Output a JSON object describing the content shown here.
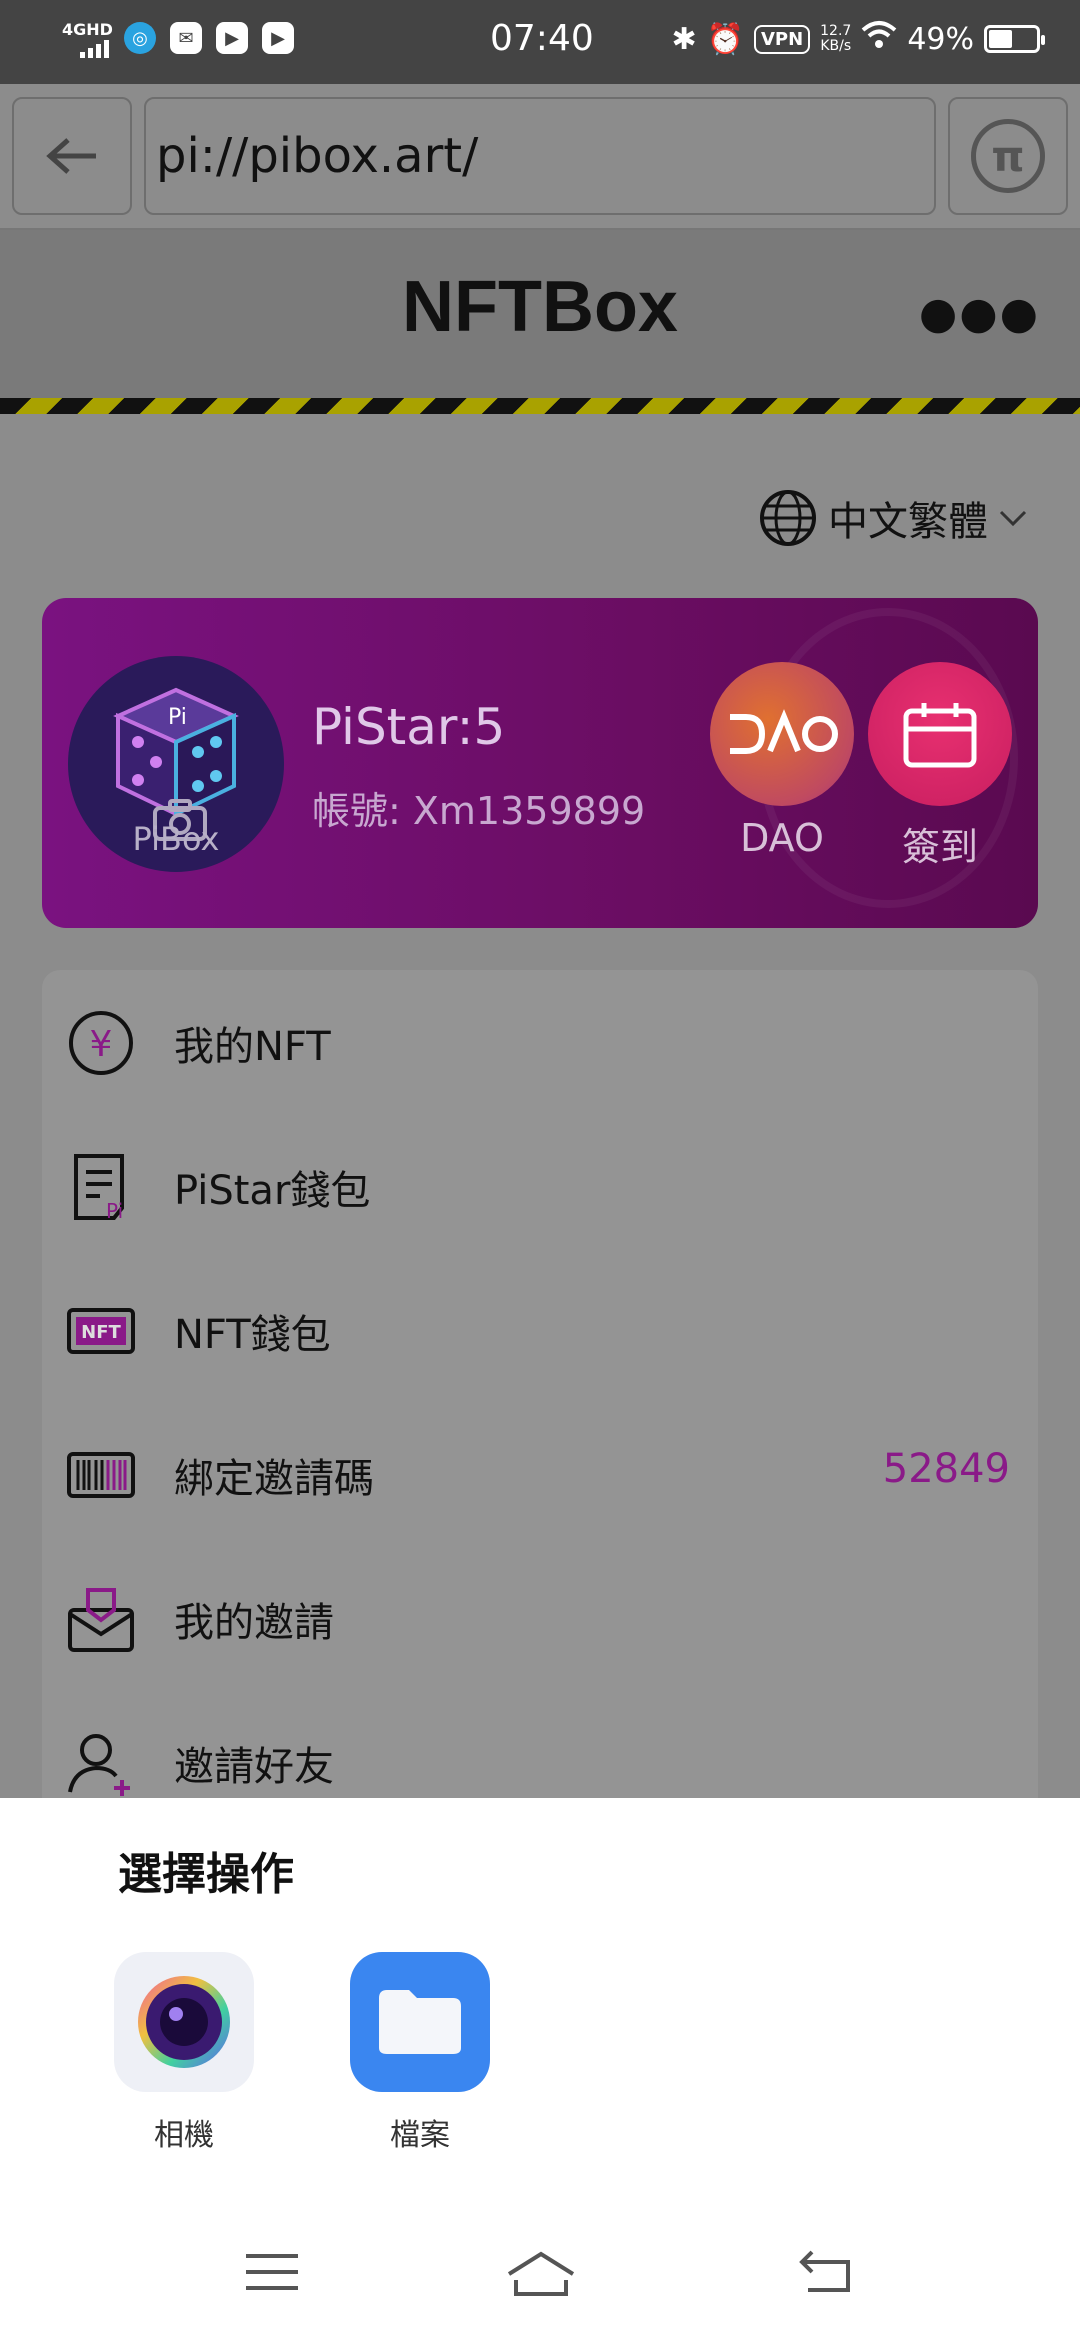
{
  "status_bar": {
    "network": "4GHD",
    "time": "07:40",
    "vpn": "VPN",
    "speed_value": "12.7",
    "speed_unit": "KB/s",
    "battery": "49%",
    "battery_level": 0.49
  },
  "browser": {
    "url": "pi://pibox.art/"
  },
  "header": {
    "title": "NFTBox"
  },
  "language": {
    "label": "中文繁體"
  },
  "profile": {
    "avatar_label": "PiBox",
    "pistar": "PiStar:5",
    "account": "帳號: Xm1359899",
    "dao_label": "DAO",
    "signin_label": "簽到"
  },
  "menu": {
    "items": [
      {
        "label": "我的NFT",
        "icon": "yen-circle-icon",
        "value": ""
      },
      {
        "label": "PiStar錢包",
        "icon": "pi-document-icon",
        "value": ""
      },
      {
        "label": "NFT錢包",
        "icon": "nft-badge-icon",
        "value": ""
      },
      {
        "label": "綁定邀請碼",
        "icon": "barcode-icon",
        "value": "52849"
      },
      {
        "label": "我的邀請",
        "icon": "mail-icon",
        "value": ""
      },
      {
        "label": "邀請好友",
        "icon": "add-user-icon",
        "value": ""
      }
    ]
  },
  "sheet": {
    "title": "選擇操作",
    "options": [
      {
        "label": "相機",
        "icon": "camera-app-icon"
      },
      {
        "label": "檔案",
        "icon": "folder-icon"
      }
    ]
  },
  "colors": {
    "accent": "#8a1a88",
    "card_gradient_start": "#7a1280",
    "card_gradient_end": "#5a0a50",
    "hazard_yellow": "#a9a200"
  }
}
